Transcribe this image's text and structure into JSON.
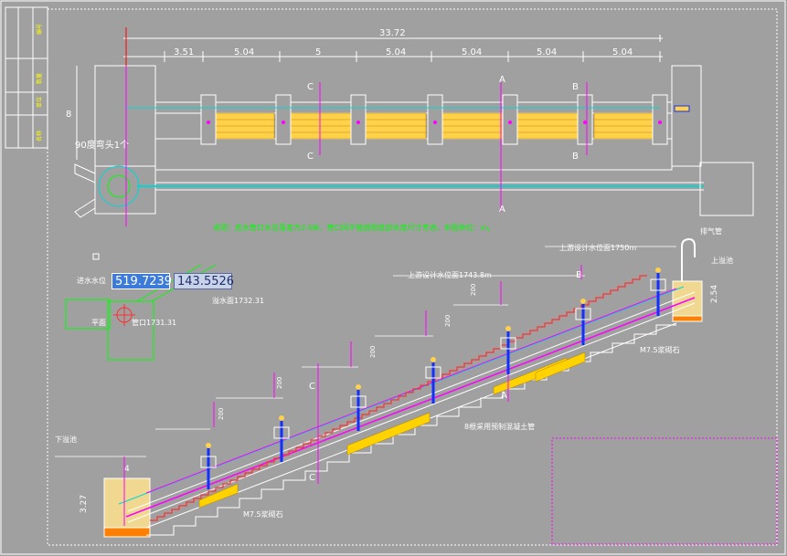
{
  "colors": {
    "background": "#a0a0a0",
    "dimension": "#ffffff",
    "magenta": "#ff00ff",
    "green": "#00ff00",
    "grate_fill": "#ffd24a",
    "step_fill": "#ffd200",
    "mortar": "#f0d890",
    "blue": "#1030ff",
    "red": "#ff3030",
    "cyan": "#00d8d8"
  },
  "plan": {
    "total_dim": "33.72",
    "seg_dims": [
      "3.51",
      "5.04",
      "5",
      "5.04",
      "5.04",
      "5.04",
      "5.04"
    ],
    "height_dim": "8",
    "elbow_note": "90度弯头1个",
    "section_c": "C",
    "section_a": "A",
    "section_b": "B",
    "note": "说明：底水管口水位落差为2.0米，管口间不能按照底部长度尺寸考虑，本图单位：m。"
  },
  "profile": {
    "label_left_top": "进水水位",
    "label_left_mid": "平面",
    "label_elev1": "管口1731.31",
    "label_elev2": "溢水面1732.31",
    "label_overflow": "下溢池",
    "label_top_water": "上游设计水位面1750m",
    "label_mid_water": "上游设计水位面1743.8m",
    "label_vent": "排气管",
    "label_upper_pool": "上溢池",
    "label_mortar1": "M7.5浆砌石",
    "label_mortar2": "M7.5浆砌石",
    "label_pipe": "8根采用预制混凝土管",
    "dim_254": "2.54",
    "dim_327": "3.27",
    "dim_4": "4",
    "dim_200": "200",
    "section_a": "A",
    "section_b": "B",
    "section_c": "C"
  },
  "title_block": {
    "labels": [
      "编号",
      "数量",
      "单位",
      "名称"
    ]
  },
  "cad_cursor": {
    "x_value": "519.7239",
    "y_value": "143.5526"
  }
}
